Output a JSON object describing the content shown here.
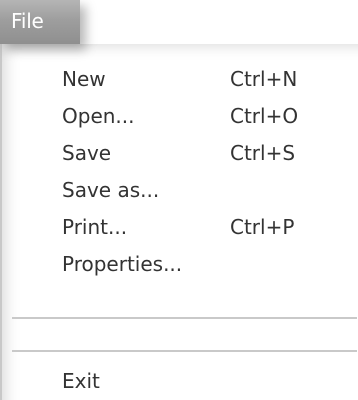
{
  "menubar": {
    "file_label": "File"
  },
  "menu": {
    "items": [
      {
        "label": "New",
        "shortcut": "Ctrl+N"
      },
      {
        "label": "Open...",
        "shortcut": "Ctrl+O"
      },
      {
        "label": "Save",
        "shortcut": "Ctrl+S"
      },
      {
        "label": "Save as...",
        "shortcut": ""
      },
      {
        "label": "Print...",
        "shortcut": "Ctrl+P"
      },
      {
        "label": "Properties...",
        "shortcut": ""
      }
    ],
    "exit_label": "Exit"
  }
}
